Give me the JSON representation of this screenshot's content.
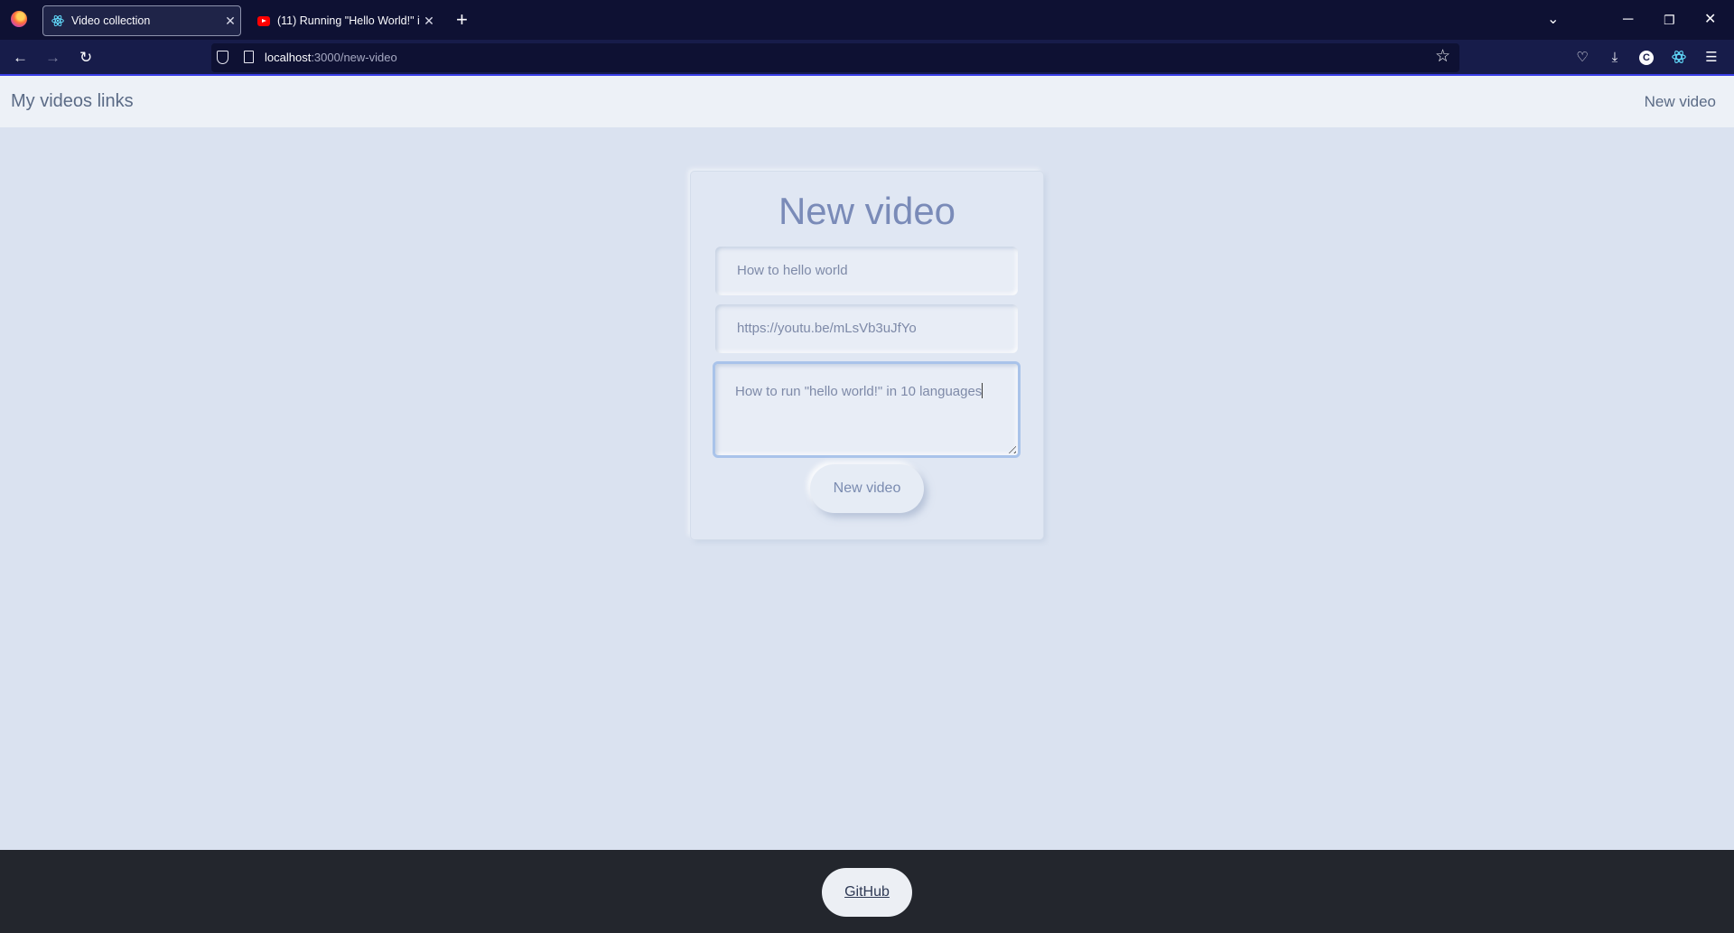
{
  "browser": {
    "tabs": [
      {
        "title": "Video collection",
        "active": true,
        "icon": "react-icon"
      },
      {
        "title": "(11) Running \"Hello World!\" in",
        "active": false,
        "icon": "youtube-icon"
      }
    ],
    "url": {
      "host": "localhost",
      "path": ":3000/new-video"
    }
  },
  "header": {
    "site_title": "My videos links",
    "nav_link": "New video"
  },
  "form": {
    "title": "New video",
    "title_field_value": "How to hello world",
    "url_field_value": "https://youtu.be/mLsVb3uJfYo",
    "description_value": "How to run \"hello world!\" in 10 languages",
    "submit_label": "New video"
  },
  "footer": {
    "github_label": "GitHub"
  }
}
